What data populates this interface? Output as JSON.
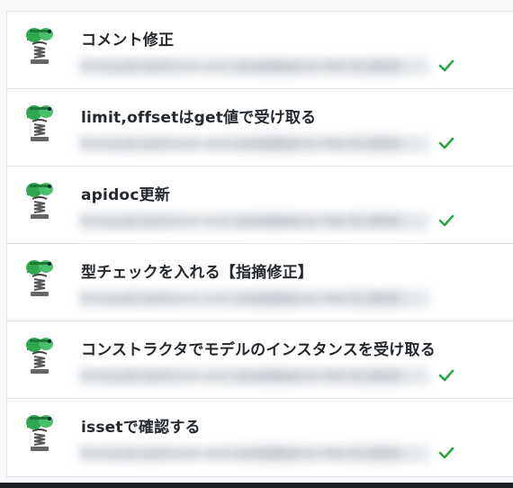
{
  "commits": [
    {
      "title": "コメント修正",
      "meta": "Tomoyuki authored and committed on Mar 9, 2018",
      "verified": true
    },
    {
      "title": "limit,offsetはget値で受け取る",
      "meta": "Tomoyuki authored and committed on Mar 9, 2018",
      "verified": true
    },
    {
      "title": "apidoc更新",
      "meta": "Tomoyuki authored and committed on Mar 9, 2018",
      "verified": true
    },
    {
      "title": "型チェックを入れる【指摘修正】",
      "meta": "Tomoyuki authored and committed on Mar 9, 2018",
      "verified": false
    },
    {
      "title": "コンストラクタでモデルのインスタンスを受け取る",
      "meta": "Tomoyuki authored and committed on Mar 9, 2018",
      "verified": true
    },
    {
      "title": "issetで確認する",
      "meta": "Tomoyuki authored and committed on Mar 9, 2018",
      "verified": true
    }
  ],
  "colors": {
    "check": "#28a745",
    "title": "#24292e",
    "border": "#e1e4e8"
  },
  "icons": {
    "avatar": "spring-rider-toy-avatar",
    "status": "check-icon"
  }
}
